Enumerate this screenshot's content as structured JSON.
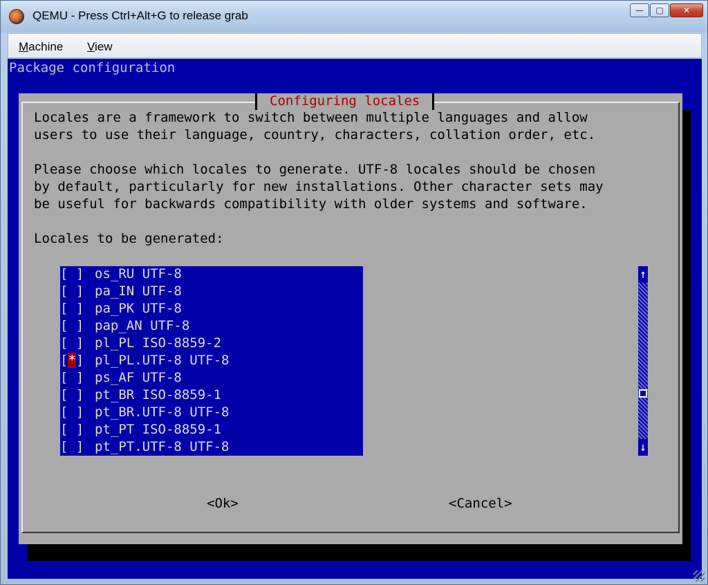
{
  "window": {
    "title": "QEMU - Press Ctrl+Alt+G to release grab",
    "minimize_glyph": "—",
    "maximize_glyph": "▢",
    "close_glyph": "✕"
  },
  "menu": {
    "machine_first": "M",
    "machine_rest": "achine",
    "view_first": "V",
    "view_rest": "iew"
  },
  "console": {
    "backtitle": "Package configuration",
    "dialog_title": "Configuring locales",
    "paragraph1": [
      "Locales are a framework to switch between multiple languages and allow",
      "users to use their language, country, characters, collation order, etc."
    ],
    "paragraph2": [
      "Please choose which locales to generate. UTF-8 locales should be chosen",
      "by default, particularly for new installations. Other character sets may",
      "be useful for backwards compatibility with older systems and software."
    ],
    "list_label": "Locales to be generated:",
    "locales": [
      {
        "checked": false,
        "label": "os_RU UTF-8"
      },
      {
        "checked": false,
        "label": "pa_IN UTF-8"
      },
      {
        "checked": false,
        "label": "pa_PK UTF-8"
      },
      {
        "checked": false,
        "label": "pap_AN UTF-8"
      },
      {
        "checked": false,
        "label": "pl_PL ISO-8859-2"
      },
      {
        "checked": true,
        "label": "pl_PL.UTF-8 UTF-8"
      },
      {
        "checked": false,
        "label": "ps_AF UTF-8"
      },
      {
        "checked": false,
        "label": "pt_BR ISO-8859-1"
      },
      {
        "checked": false,
        "label": "pt_BR.UTF-8 UTF-8"
      },
      {
        "checked": false,
        "label": "pt_PT ISO-8859-1"
      },
      {
        "checked": false,
        "label": "pt_PT.UTF-8 UTF-8"
      }
    ],
    "ok_label": "<Ok>",
    "cancel_label": "<Cancel>",
    "scroll_up_glyph": "↑",
    "scroll_down_glyph": "↓"
  },
  "colors": {
    "console_bg": "#0000a8",
    "dialog_bg": "#aaaaaa",
    "title_red": "#a80000"
  }
}
